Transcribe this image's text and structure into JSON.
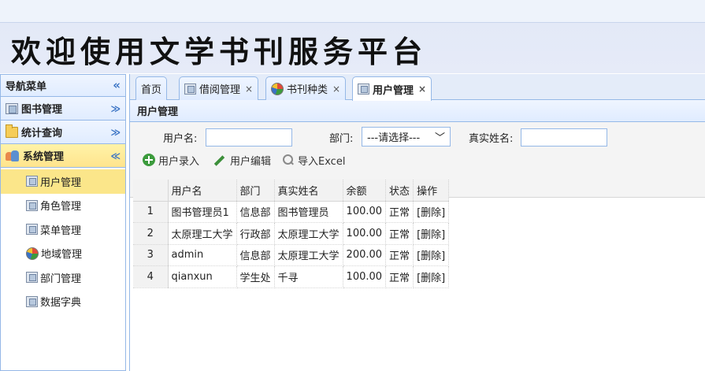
{
  "header": {
    "title": "欢迎使用文学书刊服务平台"
  },
  "nav": {
    "title": "导航菜单",
    "groups": [
      {
        "label": "图书管理",
        "icon": "book-icon"
      },
      {
        "label": "统计查询",
        "icon": "folder-icon"
      },
      {
        "label": "系统管理",
        "icon": "users-icon"
      }
    ],
    "items": [
      {
        "label": "用户管理",
        "icon": "page-icon"
      },
      {
        "label": "角色管理",
        "icon": "page-icon"
      },
      {
        "label": "菜单管理",
        "icon": "page-icon"
      },
      {
        "label": "地域管理",
        "icon": "pie-chart-icon"
      },
      {
        "label": "部门管理",
        "icon": "page-icon"
      },
      {
        "label": "数据字典",
        "icon": "page-icon"
      }
    ]
  },
  "tabs": [
    {
      "label": "首页"
    },
    {
      "label": "借阅管理",
      "close": "×"
    },
    {
      "label": "书刊种类",
      "close": "×"
    },
    {
      "label": "用户管理",
      "close": "×"
    }
  ],
  "panel": {
    "title": "用户管理"
  },
  "filters": {
    "username_label": "用户名:",
    "username_value": "",
    "department_label": "部门:",
    "department_selected": "---请选择---",
    "realname_label": "真实姓名:",
    "realname_value": ""
  },
  "toolbar": {
    "add_label": "用户录入",
    "edit_label": "用户编辑",
    "export_label": "导入Excel"
  },
  "table": {
    "columns": [
      "用户名",
      "部门",
      "真实姓名",
      "余额",
      "状态",
      "操作"
    ],
    "rows": [
      {
        "num": "1",
        "username": "图书管理员1",
        "department": "信息部",
        "realname": "图书管理员",
        "balance": "100.00",
        "status": "正常",
        "action": "[删除]"
      },
      {
        "num": "2",
        "username": "太原理工大学",
        "department": "行政部",
        "realname": "太原理工大学",
        "balance": "100.00",
        "status": "正常",
        "action": "[删除]"
      },
      {
        "num": "3",
        "username": "admin",
        "department": "信息部",
        "realname": "太原理工大学",
        "balance": "200.00",
        "status": "正常",
        "action": "[删除]"
      },
      {
        "num": "4",
        "username": "qianxun",
        "department": "学生处",
        "realname": "千寻",
        "balance": "100.00",
        "status": "正常",
        "action": "[删除]"
      }
    ]
  }
}
